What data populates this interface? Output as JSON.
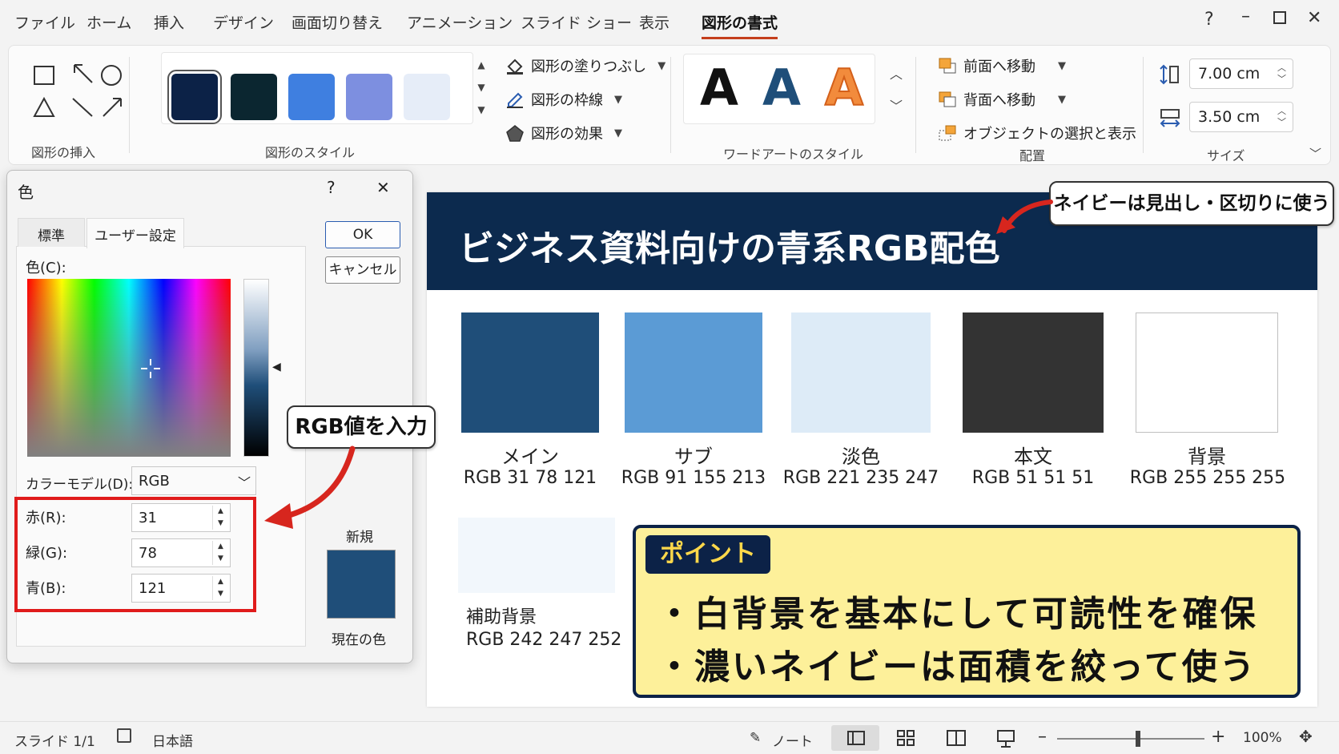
{
  "menu": {
    "items": [
      "ファイル",
      "ホーム",
      "挿入",
      "デザイン",
      "画面切り替え",
      "アニメーション",
      "スライド ショー",
      "表示",
      "図形の書式"
    ],
    "active": "図形の書式",
    "help": "?"
  },
  "ribbon": {
    "insert_shapes_label": "図形の挿入",
    "shape_styles_label": "図形のスタイル",
    "shape_style_swatches": [
      "#0c2247",
      "#0b2630",
      "#3f7fe0",
      "#7d8fe0",
      "#e6edf8"
    ],
    "fill": "図形の塗りつぶし",
    "outline": "図形の枠線",
    "effects": "図形の効果",
    "wordart_label": "ワードアートのスタイル",
    "wordart_letter": "A",
    "bring_forward": "前面へ移動",
    "send_backward": "背面へ移動",
    "selection_pane": "オブジェクトの選択と表示",
    "arrange_label": "配置",
    "height": "7.00 cm",
    "width": "3.50 cm",
    "size_label": "サイズ"
  },
  "dialog": {
    "title": "色",
    "help": "?",
    "tabs": [
      "標準",
      "ユーザー設定"
    ],
    "active_tab": "ユーザー設定",
    "colors_label": "色(C):",
    "ok": "OK",
    "cancel": "キャンセル",
    "color_model_label": "カラーモデル(D):",
    "color_model": "RGB",
    "red_label": "赤(R):",
    "green_label": "緑(G):",
    "blue_label": "青(B):",
    "red": "31",
    "green": "78",
    "blue": "121",
    "new_label": "新規",
    "current_label": "現在の色",
    "new_color": "#1f4e79"
  },
  "annotations": {
    "rgb_input": "RGB値を入力",
    "navy_note": "ネイビーは見出し・区切りに使う"
  },
  "slide": {
    "title": "ビジネス資料向けの青系RGB配色",
    "header_color": "#0c2a4e",
    "cards": [
      {
        "name": "メイン",
        "rgb": "RGB 31 78 121",
        "color": "#1f4e79"
      },
      {
        "name": "サブ",
        "rgb": "RGB 91 155 213",
        "color": "#5b9bd5"
      },
      {
        "name": "淡色",
        "rgb": "RGB 221 235 247",
        "color": "#ddebf7"
      },
      {
        "name": "本文",
        "rgb": "RGB 51 51 51",
        "color": "#333333"
      },
      {
        "name": "背景",
        "rgb": "RGB 255 255 255",
        "color": "#ffffff"
      },
      {
        "name": "補助背景",
        "rgb": "RGB 242 247 252",
        "color": "#f2f7fc"
      }
    ],
    "point_tag": "ポイント",
    "bullets": [
      "・白背景を基本にして可読性を確保",
      "・濃いネイビーは面積を絞って使う"
    ]
  },
  "status": {
    "slide": "スライド 1/1",
    "language": "日本語",
    "notes": "ノート",
    "zoom": "100%",
    "zoom_level": 0.55
  }
}
